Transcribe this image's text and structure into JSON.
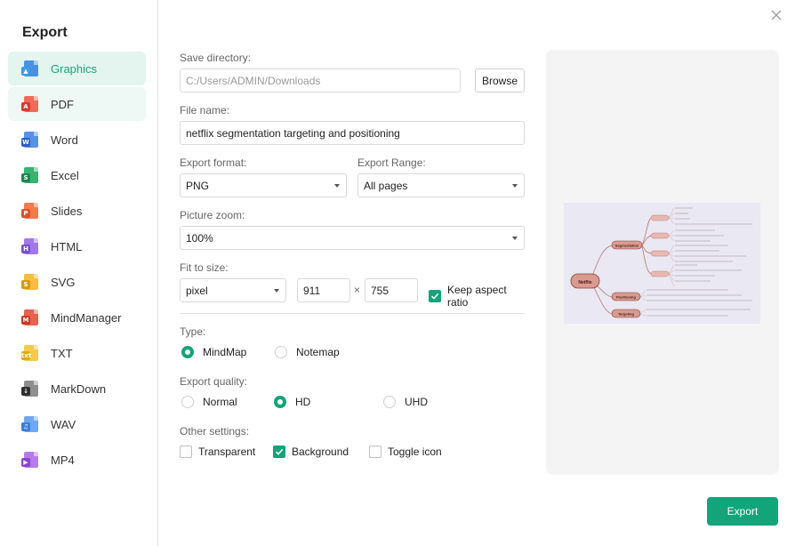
{
  "title": "Export",
  "sidebar": {
    "items": [
      {
        "label": "Graphics",
        "color": "#4a90e2",
        "badge": "▲",
        "badge_color": "#3d9ae8"
      },
      {
        "label": "PDF",
        "color": "#f06b5d",
        "badge": "A",
        "badge_color": "#d93a2b"
      },
      {
        "label": "Word",
        "color": "#5a8fe8",
        "badge": "W",
        "badge_color": "#2b5fc9"
      },
      {
        "label": "Excel",
        "color": "#35b36f",
        "badge": "S",
        "badge_color": "#17894b"
      },
      {
        "label": "Slides",
        "color": "#f27a4e",
        "badge": "P",
        "badge_color": "#d9532a"
      },
      {
        "label": "HTML",
        "color": "#a178e8",
        "badge": "H",
        "badge_color": "#7a4fd1"
      },
      {
        "label": "SVG",
        "color": "#f5be3d",
        "badge": "S",
        "badge_color": "#d99a13"
      },
      {
        "label": "MindManager",
        "color": "#e8604f",
        "badge": "M",
        "badge_color": "#c9392a"
      },
      {
        "label": "TXT",
        "color": "#f5c94a",
        "badge": "txt",
        "badge_color": "#e0a919"
      },
      {
        "label": "MarkDown",
        "color": "#8e8e8e",
        "badge": "↓",
        "badge_color": "#2f2f2f"
      },
      {
        "label": "WAV",
        "color": "#6fa8ee",
        "badge": "♫",
        "badge_color": "#3d7fd9"
      },
      {
        "label": "MP4",
        "color": "#b77be8",
        "badge": "▶",
        "badge_color": "#8a45d1"
      }
    ]
  },
  "form": {
    "save_directory_label": "Save directory:",
    "save_directory_value": "C:/Users/ADMIN/Downloads",
    "browse_label": "Browse",
    "file_name_label": "File name:",
    "file_name_value": "netflix segmentation targeting and positioning",
    "export_format_label": "Export format:",
    "export_format_value": "PNG",
    "export_range_label": "Export Range:",
    "export_range_value": "All pages",
    "picture_zoom_label": "Picture zoom:",
    "picture_zoom_value": "100%",
    "fit_to_size_label": "Fit to size:",
    "fit_unit_value": "pixel",
    "width_value": "911",
    "times_sign": "×",
    "height_value": "755",
    "keep_aspect_label": "Keep aspect ratio",
    "type_label": "Type:",
    "type_mindmap": "MindMap",
    "type_notemap": "Notemap",
    "quality_label": "Export quality:",
    "quality_normal": "Normal",
    "quality_hd": "HD",
    "quality_uhd": "UHD",
    "other_label": "Other settings:",
    "transparent_label": "Transparent",
    "background_label": "Background",
    "toggle_icon_label": "Toggle icon"
  },
  "preview": {
    "central": "Netflix",
    "branches": [
      "Segmentation",
      "Positioning",
      "Targeting"
    ]
  },
  "export_label": "Export",
  "colors": {
    "accent": "#13a479",
    "active_bg": "#e4f5ef"
  }
}
